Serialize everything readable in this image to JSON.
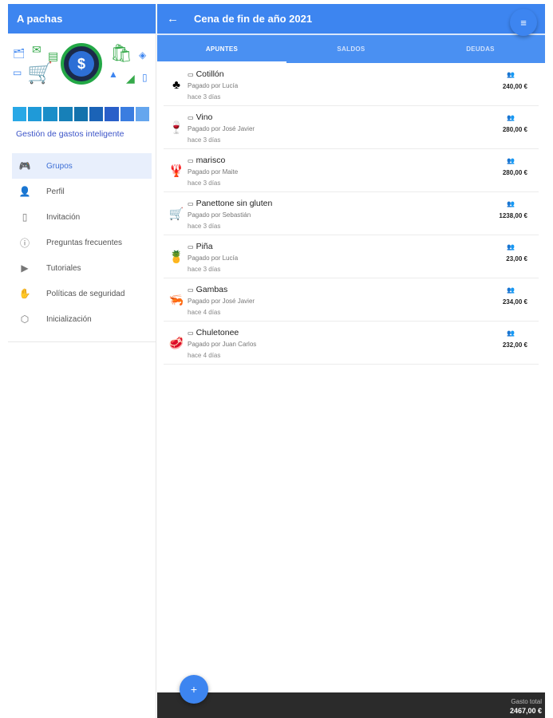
{
  "sidebar": {
    "title": "A pachas",
    "brand_text": "Gestión de gastos inteligente",
    "palette": [
      "#29a8e6",
      "#1f9ad8",
      "#1a8ec9",
      "#1780b8",
      "#1372ad",
      "#1b63b7",
      "#2a5fc9",
      "#3a7de0",
      "#65a6ee"
    ],
    "items": [
      {
        "label": "Grupos",
        "icon": "gamepad-icon"
      },
      {
        "label": "Perfil",
        "icon": "user-icon"
      },
      {
        "label": "Invitación",
        "icon": "phone-icon"
      },
      {
        "label": "Preguntas frecuentes",
        "icon": "info-icon"
      },
      {
        "label": "Tutoriales",
        "icon": "play-icon"
      },
      {
        "label": "Políticas de seguridad",
        "icon": "hand-icon"
      },
      {
        "label": "Inicialización",
        "icon": "hexagon-icon"
      }
    ]
  },
  "header": {
    "back_icon": "←",
    "title": "Cena de fin de año 2021",
    "menu_icon": "≡"
  },
  "tabs": [
    {
      "label": "APUNTES"
    },
    {
      "label": "SALDOS"
    },
    {
      "label": "DEUDAS"
    }
  ],
  "expenses": [
    {
      "icon": "♣",
      "name": "Cotillón",
      "payer": "Pagado por Lucía",
      "when": "hace 3 días",
      "people": "👥",
      "amount": "240,00 €"
    },
    {
      "icon": "🍷",
      "name": "Vino",
      "payer": "Pagado por José Javier",
      "when": "hace 3 días",
      "people": "👥",
      "amount": "280,00 €"
    },
    {
      "icon": "🦞",
      "name": "marisco",
      "payer": "Pagado por Maite",
      "when": "hace 3 días",
      "people": "👥",
      "amount": "280,00 €"
    },
    {
      "icon": "🛒",
      "name": "Panettone sin gluten",
      "payer": "Pagado por Sebastián",
      "when": "hace 3 días",
      "people": "👥",
      "amount": "1238,00 €"
    },
    {
      "icon": "🍍",
      "name": "Piña",
      "payer": "Pagado por Lucía",
      "when": "hace 3 días",
      "people": "👥",
      "amount": "23,00 €"
    },
    {
      "icon": "🦐",
      "name": "Gambas",
      "payer": "Pagado por José Javier",
      "when": "hace 4 días",
      "people": "👥",
      "amount": "234,00 €"
    },
    {
      "icon": "🥩",
      "name": "Chuletonee",
      "payer": "Pagado por Juan Carlos",
      "when": "hace 4 días",
      "people": "👥",
      "amount": "232,00 €"
    }
  ],
  "footer": {
    "total_label": "Gasto total",
    "total_value": "2467,00 €",
    "add_icon": "+"
  }
}
